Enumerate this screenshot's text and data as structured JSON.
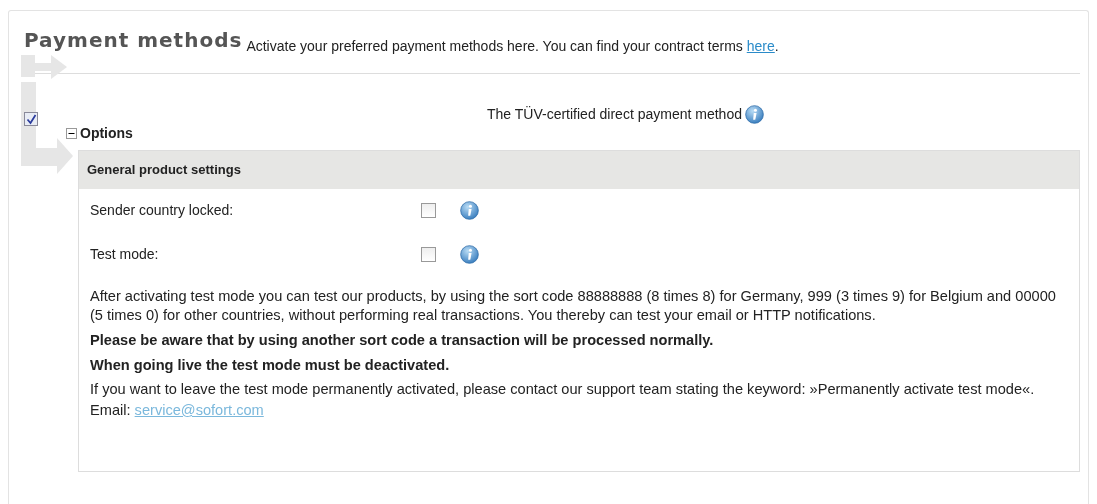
{
  "title": "Payment methods",
  "intro": {
    "text": "Activate your preferred payment methods here. You can find your contract terms ",
    "link": "here",
    "end": "."
  },
  "method": {
    "enabled": true,
    "description": "The TÜV-certified direct payment method"
  },
  "options": {
    "label": "Options",
    "expanded": true
  },
  "panel": {
    "heading": "General product settings",
    "settings": [
      {
        "label": "Sender country locked:",
        "checked": false
      },
      {
        "label": "Test mode:",
        "checked": false
      }
    ],
    "notes": [
      {
        "text": "After activating test mode you can test our products, by using the sort code 88888888 (8 times 8) for Germany, 999 (3 times 9) for Belgium and 00000 (5 times 0) for other countries, without performing real transactions. You thereby can test your email or HTTP notifications.",
        "bold": false
      },
      {
        "text": "Please be aware that by using another sort code a transaction will be processed normally.",
        "bold": true
      },
      {
        "text": "When going live the test mode must be deactivated.",
        "bold": true
      },
      {
        "text": "If you want to leave the test mode permanently activated, please contact our support team stating the keyword: »Permanently activate test mode«.",
        "bold": false
      }
    ],
    "email_label": "Email:",
    "email": "service@sofort.com"
  }
}
